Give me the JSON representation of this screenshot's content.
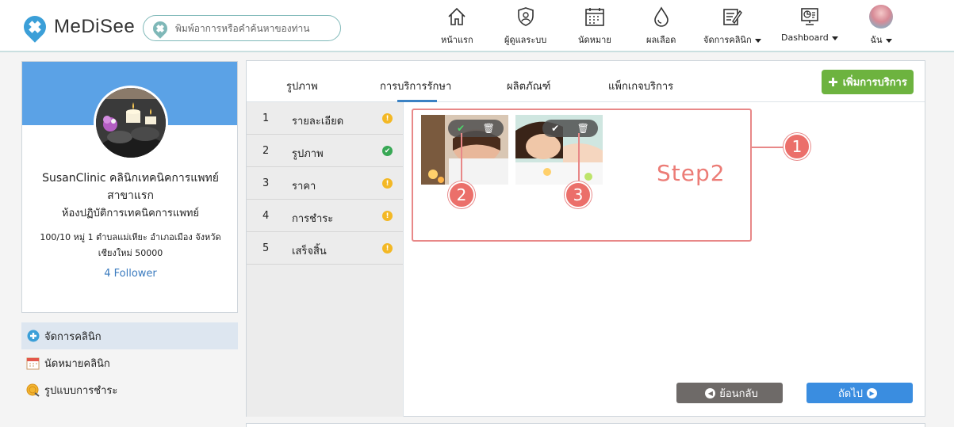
{
  "brand": {
    "name": "MeDiSee"
  },
  "search": {
    "placeholder": "พิมพ์อาการหรือคำค้นหาของท่าน"
  },
  "nav": [
    {
      "label": "หน้าแรก",
      "icon": "home-icon"
    },
    {
      "label": "ผู้ดูแลระบบ",
      "icon": "admin-shield-icon"
    },
    {
      "label": "นัดหมาย",
      "icon": "calendar-icon"
    },
    {
      "label": "ผลเลือด",
      "icon": "blood-drop-icon"
    },
    {
      "label": "จัดการคลินิก",
      "icon": "edit-note-icon",
      "dropdown": true
    },
    {
      "label": "Dashboard",
      "icon": "dashboard-chart-icon",
      "dropdown": true
    },
    {
      "label": "ฉัน",
      "icon": "user-avatar",
      "dropdown": true
    }
  ],
  "profile": {
    "name": "SusanClinic คลินิกเทคนิคการแพทย์",
    "branch": "สาขาแรก",
    "type": "ห้องปฏิบัติการเทคนิคการแพทย์",
    "address_line1": "100/10 หมู่ 1 ตำบลแม่เหียะ อำเภอเมือง จังหวัด",
    "address_line2": "เชียงใหม่ 50000",
    "followers": "4 Follower"
  },
  "side_menu": [
    {
      "label": "จัดการคลินิก",
      "icon": "clinic-plus-icon",
      "active": true
    },
    {
      "label": "นัดหมายคลินิก",
      "icon": "calendar-icon",
      "active": false
    },
    {
      "label": "รูปแบบการชำระ",
      "icon": "payment-coin-icon",
      "active": false
    }
  ],
  "tabs": [
    {
      "label": "รูปภาพ"
    },
    {
      "label": "การบริการรักษา",
      "active": true
    },
    {
      "label": "ผลิตภัณฑ์"
    },
    {
      "label": "แพ็กเกจบริการ"
    }
  ],
  "add_service_label": "เพิ่มการบริการ",
  "steps": [
    {
      "num": "1",
      "label": "รายละเอียด",
      "status": "warning"
    },
    {
      "num": "2",
      "label": "รูปภาพ",
      "status": "done"
    },
    {
      "num": "3",
      "label": "ราคา",
      "status": "warning"
    },
    {
      "num": "4",
      "label": "การชำระ",
      "status": "warning"
    },
    {
      "num": "5",
      "label": "เสร็จสิ้น",
      "status": "warning"
    }
  ],
  "images": [
    {
      "name": "spa-image-1",
      "selected": true
    },
    {
      "name": "spa-image-2",
      "selected": false
    }
  ],
  "annotations": {
    "step_title": "Step2",
    "markers": [
      "1",
      "2",
      "3"
    ]
  },
  "buttons": {
    "back": "ย้อนกลับ",
    "next": "ถัดไป"
  },
  "colors": {
    "brand_blue": "#3b9fd8",
    "profile_band": "#5ba2e6",
    "add_green": "#6db33f",
    "next_blue": "#3a8de0",
    "back_gray": "#6e6a68",
    "annotation_red": "#eb6f6a",
    "warning": "#f3b825",
    "ok": "#38a855"
  }
}
